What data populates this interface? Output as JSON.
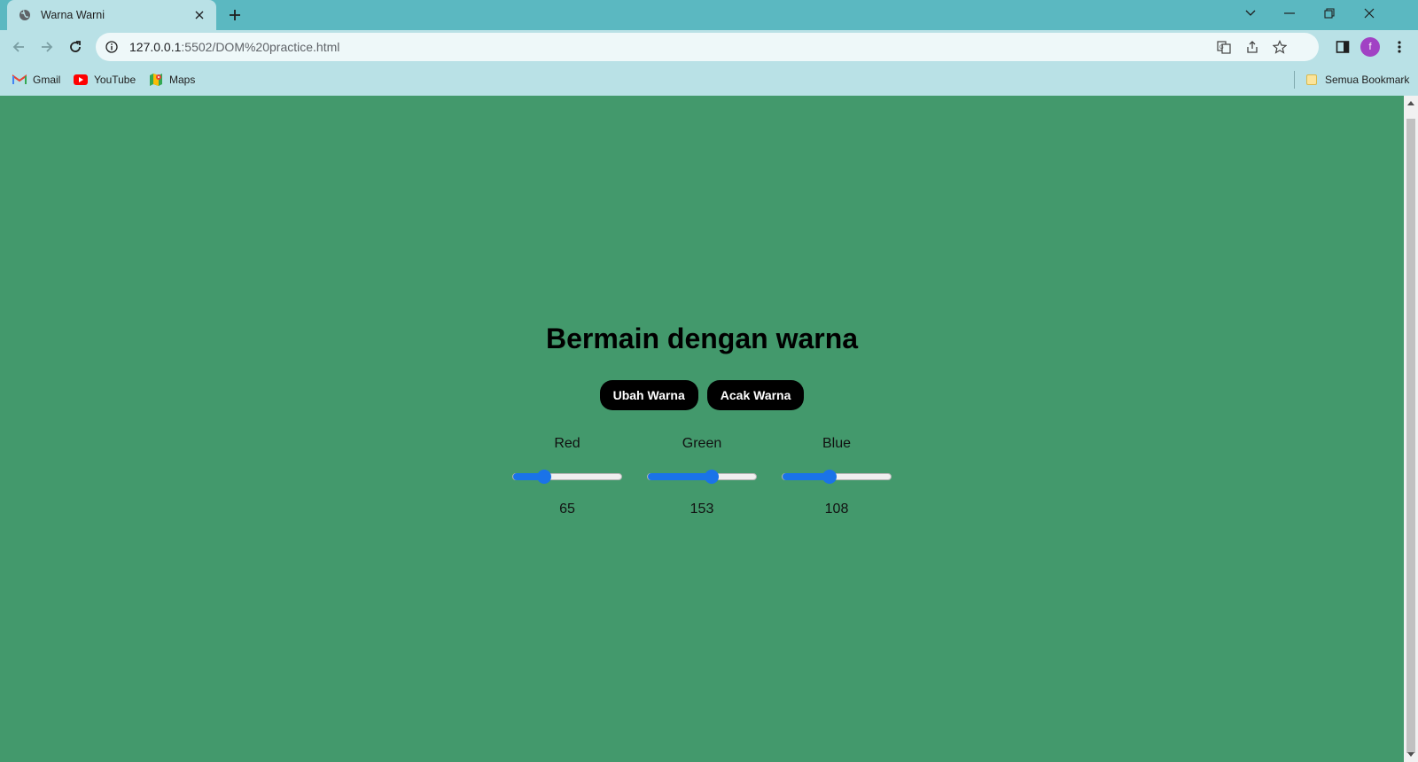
{
  "browser": {
    "tab_title": "Warna Warni",
    "url_host": "127.0.0.1",
    "url_path": ":5502/DOM%20practice.html",
    "profile_initial": "f",
    "bookmarks": [
      {
        "label": "Gmail",
        "icon": "gmail-icon"
      },
      {
        "label": "YouTube",
        "icon": "youtube-icon"
      },
      {
        "label": "Maps",
        "icon": "maps-icon"
      }
    ],
    "all_bookmarks_label": "Semua Bookmark"
  },
  "page": {
    "background_color": "#43996c",
    "heading": "Bermain dengan warna",
    "buttons": {
      "change": "Ubah Warna",
      "random": "Acak Warna"
    },
    "sliders": [
      {
        "label": "Red",
        "value": "65",
        "max": 255
      },
      {
        "label": "Green",
        "value": "153",
        "max": 255
      },
      {
        "label": "Blue",
        "value": "108",
        "max": 255
      }
    ]
  },
  "colors": {
    "tab_strip": "#5bb8c1",
    "toolbar": "#b9e1e6",
    "slider_accent": "#1a73e8",
    "button_bg": "#000000"
  }
}
